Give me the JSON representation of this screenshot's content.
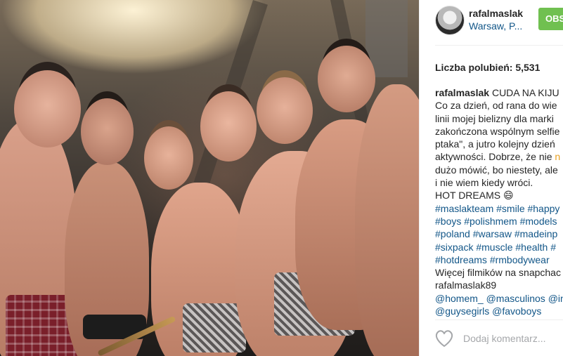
{
  "post": {
    "username": "rafalmaslak",
    "location": "Warsaw, P...",
    "follow_label": "OBS",
    "likes_text": "Liczba polubień: 5,531"
  },
  "caption": {
    "line1_user": "rafalmaslak",
    "line1_text": " CUDA NA KIJU",
    "line2": "Co za dzień, od rana do wie",
    "line3": "linii mojej bielizny dla marki",
    "line4": "zakończona wspólnym selfie",
    "line5": "ptaka\", a jutro kolejny dzień",
    "line6_a": "aktywności. Dobrze, że nie ",
    "line6_b": "n",
    "line7_a": "dużo mówić, bo niestety, ale",
    "line8": "i nie wiem kiedy wróci.",
    "line9": "HOT DREAMS 😄",
    "hashtags_line1": "#maslakteam #smile #happy",
    "hashtags_line2": "#boys #polishmem #models",
    "hashtags_line3": "#poland #warsaw #madeinp",
    "hashtags_line4": "#sixpack #muscle #health #",
    "hashtags_line5": "#hotdreams #rmbodywear",
    "snapchat_line1": "Więcej filmików na snapchac",
    "snapchat_line2": "rafalmaslak89",
    "mentions_line1": "@homem_ @masculinos @in",
    "mentions_line2": "@guysegirls @favoboys"
  },
  "comment": {
    "placeholder": "Dodaj komentarz..."
  },
  "icons": {
    "like": "heart-icon"
  },
  "colors": {
    "follow_button": "#70c050",
    "link": "#125688",
    "text": "#262626",
    "placeholder": "#a5a7aa"
  }
}
